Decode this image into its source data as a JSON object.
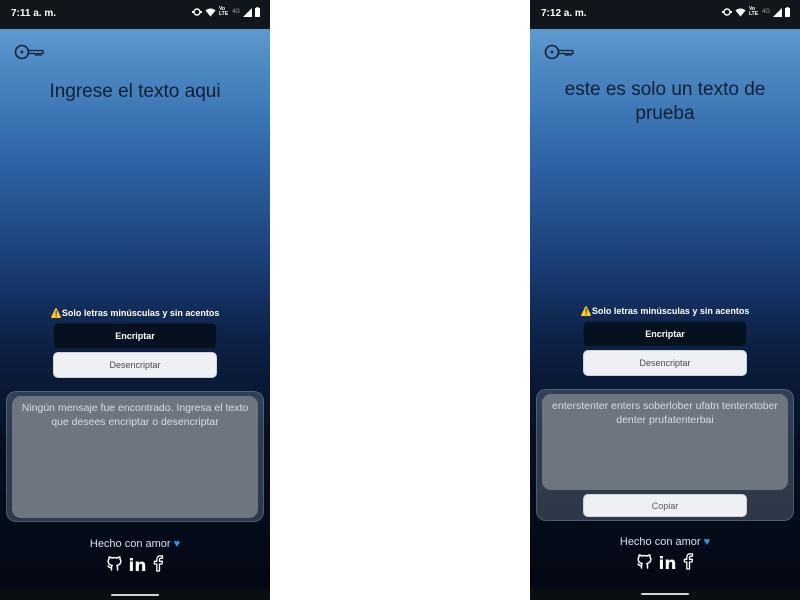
{
  "left_screen": {
    "status": {
      "time": "7:11 a. m.",
      "network": "4G",
      "volte": "Vo LTE"
    },
    "title": "Ingrese el texto aqui",
    "warning": "Solo letras minúsculas y sin acentos",
    "encrypt_label": "Encriptar",
    "decrypt_label": "Desencriptar",
    "output_text": "Ningún mensaje fue encontrado. Ingresa el texto que desees encriptar o desencriptar",
    "footer_text": "Hecho con amor",
    "icons": [
      "key-icon",
      "warning-icon",
      "heart-icon",
      "github-icon",
      "linkedin-icon",
      "facebook-icon"
    ]
  },
  "right_screen": {
    "status": {
      "time": "7:12 a. m.",
      "network": "4G",
      "volte": "Vo LTE"
    },
    "title": "este es solo un texto de prueba",
    "warning": "Solo letras minúsculas y sin acentos",
    "encrypt_label": "Encriptar",
    "decrypt_label": "Desencriptar",
    "output_text": "enterstenter enters soberlober ufatn tenterxtober denter prufatenterbai",
    "copy_label": "Copiar",
    "footer_text": "Hecho con amor",
    "icons": [
      "key-icon",
      "warning-icon",
      "heart-icon",
      "github-icon",
      "linkedin-icon",
      "facebook-icon"
    ]
  },
  "colors": {
    "accent_dark": "#06111f",
    "heart": "#3f8de6",
    "title": "#0d1e33"
  }
}
